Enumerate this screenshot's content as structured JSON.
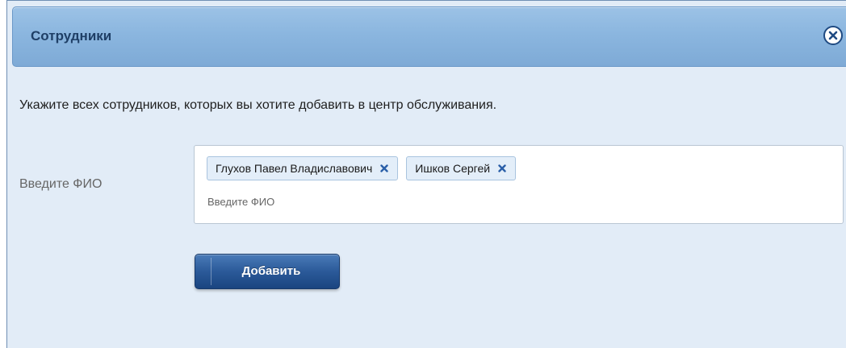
{
  "dialog": {
    "title": "Сотрудники",
    "close_icon": "close-circle-icon"
  },
  "intro_text": "Укажите всех сотрудников, которых вы хотите добавить в центр обслуживания.",
  "employee_field": {
    "label": "Введите ФИО",
    "placeholder": "Введите ФИО",
    "value": "",
    "selected": [
      {
        "name": "Глухов Павел Владиславович",
        "remove_icon": "remove-x-icon"
      },
      {
        "name": "Ишков Сергей",
        "remove_icon": "remove-x-icon"
      }
    ]
  },
  "actions": {
    "add_label": "Добавить"
  },
  "colors": {
    "header_bg": "#8bb6df",
    "title_text": "#1f3f66",
    "panel_bg": "#e2ecf7",
    "button_bg": "#2b5a99",
    "remove_x": "#2a5fa8"
  }
}
